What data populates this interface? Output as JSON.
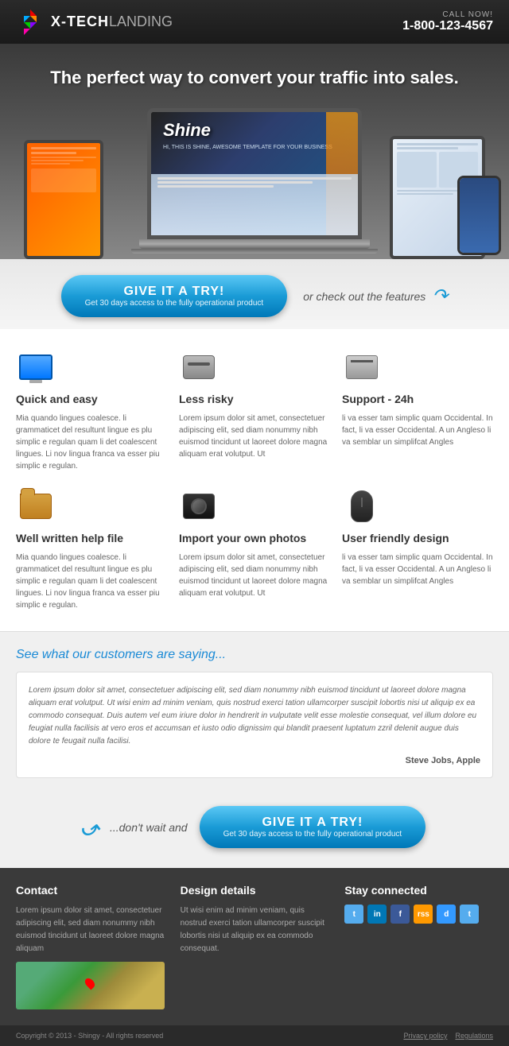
{
  "header": {
    "logo_text": "X-TECH",
    "logo_sub": "LANDING",
    "call_label": "CALL NOW!",
    "call_number": "1-800-123-4567"
  },
  "hero": {
    "headline": "The perfect way to convert your traffic into sales.",
    "screen_shine": "Shine",
    "screen_hi": "HI, THIS IS SHINE, AWESOME TEMPLATE FOR YOUR BUSINESS"
  },
  "cta": {
    "button_main": "GIVE IT A TRY!",
    "button_sub": "Get 30 days access to the fully operational product",
    "alt_text": "or check out the features"
  },
  "features": [
    {
      "icon": "monitor",
      "title": "Quick and easy",
      "text": "Mia quando lingues coalesce. li grammaticet del resultunt lingue es plu simplic e regulan quam li det coalescent lingues. Li nov lingua franca va esser piu simplic e regulan."
    },
    {
      "icon": "hdd",
      "title": "Less risky",
      "text": "Lorem ipsum dolor sit amet, consectetuer adipiscing elit, sed diam nonummy nibh euismod tincidunt ut laoreet dolore magna aliquam erat volutput. Ut"
    },
    {
      "icon": "support",
      "title": "Support - 24h",
      "text": "li va esser tam simplic quam Occidental. In fact, li va esser Occidental. A un Angleso li va semblar un simplifcat Angles"
    },
    {
      "icon": "folder",
      "title": "Well written help file",
      "text": "Mia quando lingues coalesce. li grammaticet del resultunt lingue es plu simplic e regulan quam li det coalescent lingues. Li nov lingua franca va esser piu simplic e regulan."
    },
    {
      "icon": "camera",
      "title": "Import your own photos",
      "text": "Lorem ipsum dolor sit amet, consectetuer adipiscing elit, sed diam nonummy nibh euismod tincidunt ut laoreet dolore magna aliquam erat volutput. Ut"
    },
    {
      "icon": "mouse",
      "title": "User friendly design",
      "text": "li va esser tam simplic quam Occidental. In fact, li va esser Occidental. A un Angleso li va semblar un simplifcat Angles"
    }
  ],
  "testimonial": {
    "headline": "See what our customers are saying...",
    "text": "Lorem ipsum dolor sit amet, consectetuer adipiscing elit, sed diam nonummy nibh euismod tincidunt ut laoreet dolore magna aliquam erat volutput. Ut wisi enim ad minim veniam, quis nostrud exerci tation ullamcorper suscipit lobortis nisi ut aliquip ex ea commodo consequat. Duis autem vel eum iriure dolor in hendrerit in vulputate velit esse molestie consequat, vel illum dolore eu feugiat nulla facilisis at vero eros et accumsan et iusto odio dignissim qui blandit praesent luptatum zzril delenit augue duis dolore te feugait nulla facilisi.",
    "author": "Steve Jobs, Apple"
  },
  "cta2": {
    "dont_wait": "...don't wait and",
    "button_main": "GIVE IT A TRY!",
    "button_sub": "Get 30 days access to the fully operational product"
  },
  "footer": {
    "contact": {
      "title": "Contact",
      "text": "Lorem ipsum dolor sit amet, consectetuer adipiscing elit, sed diam nonummy nibh euismod tincidunt ut laoreet dolore magna aliquam"
    },
    "design": {
      "title": "Design details",
      "text": "Ut wisi enim ad minim veniam, quis nostrud exerci tation ullamcorper suscipit lobortis nisi ut aliquip ex ea commodo consequat."
    },
    "social": {
      "title": "Stay connected",
      "icons": [
        "t",
        "in",
        "f",
        "rss",
        "d",
        "t"
      ]
    },
    "copyright": "Copyright © 2013 - Shingy - All rights reserved",
    "links": [
      "Privacy policy",
      "Regulations"
    ]
  }
}
